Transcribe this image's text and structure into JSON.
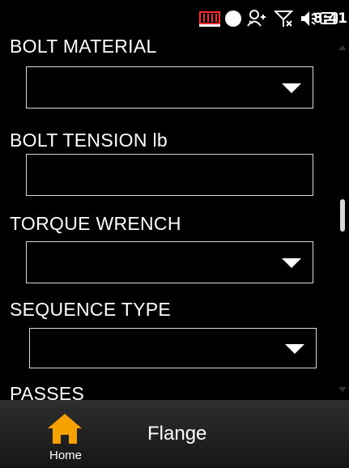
{
  "status_bar": {
    "time": "8:41",
    "icons": [
      "battery-icon",
      "record-icon",
      "contacts-sync-icon",
      "no-signal-icon",
      "volume-icon",
      "keyboard-icon"
    ]
  },
  "form": {
    "bolt_material": {
      "label": "BOLT MATERIAL",
      "value": ""
    },
    "bolt_tension": {
      "label": "BOLT TENSION lb",
      "value": ""
    },
    "torque_wrench": {
      "label": "TORQUE WRENCH",
      "value": ""
    },
    "sequence_type": {
      "label": "SEQUENCE TYPE",
      "value": ""
    },
    "passes": {
      "label": "PASSES"
    }
  },
  "bottom_bar": {
    "home_label": "Home",
    "title": "Flange"
  },
  "colors": {
    "background": "#000000",
    "home_icon": "#f5a100",
    "field_border": "#d9d9d9"
  }
}
